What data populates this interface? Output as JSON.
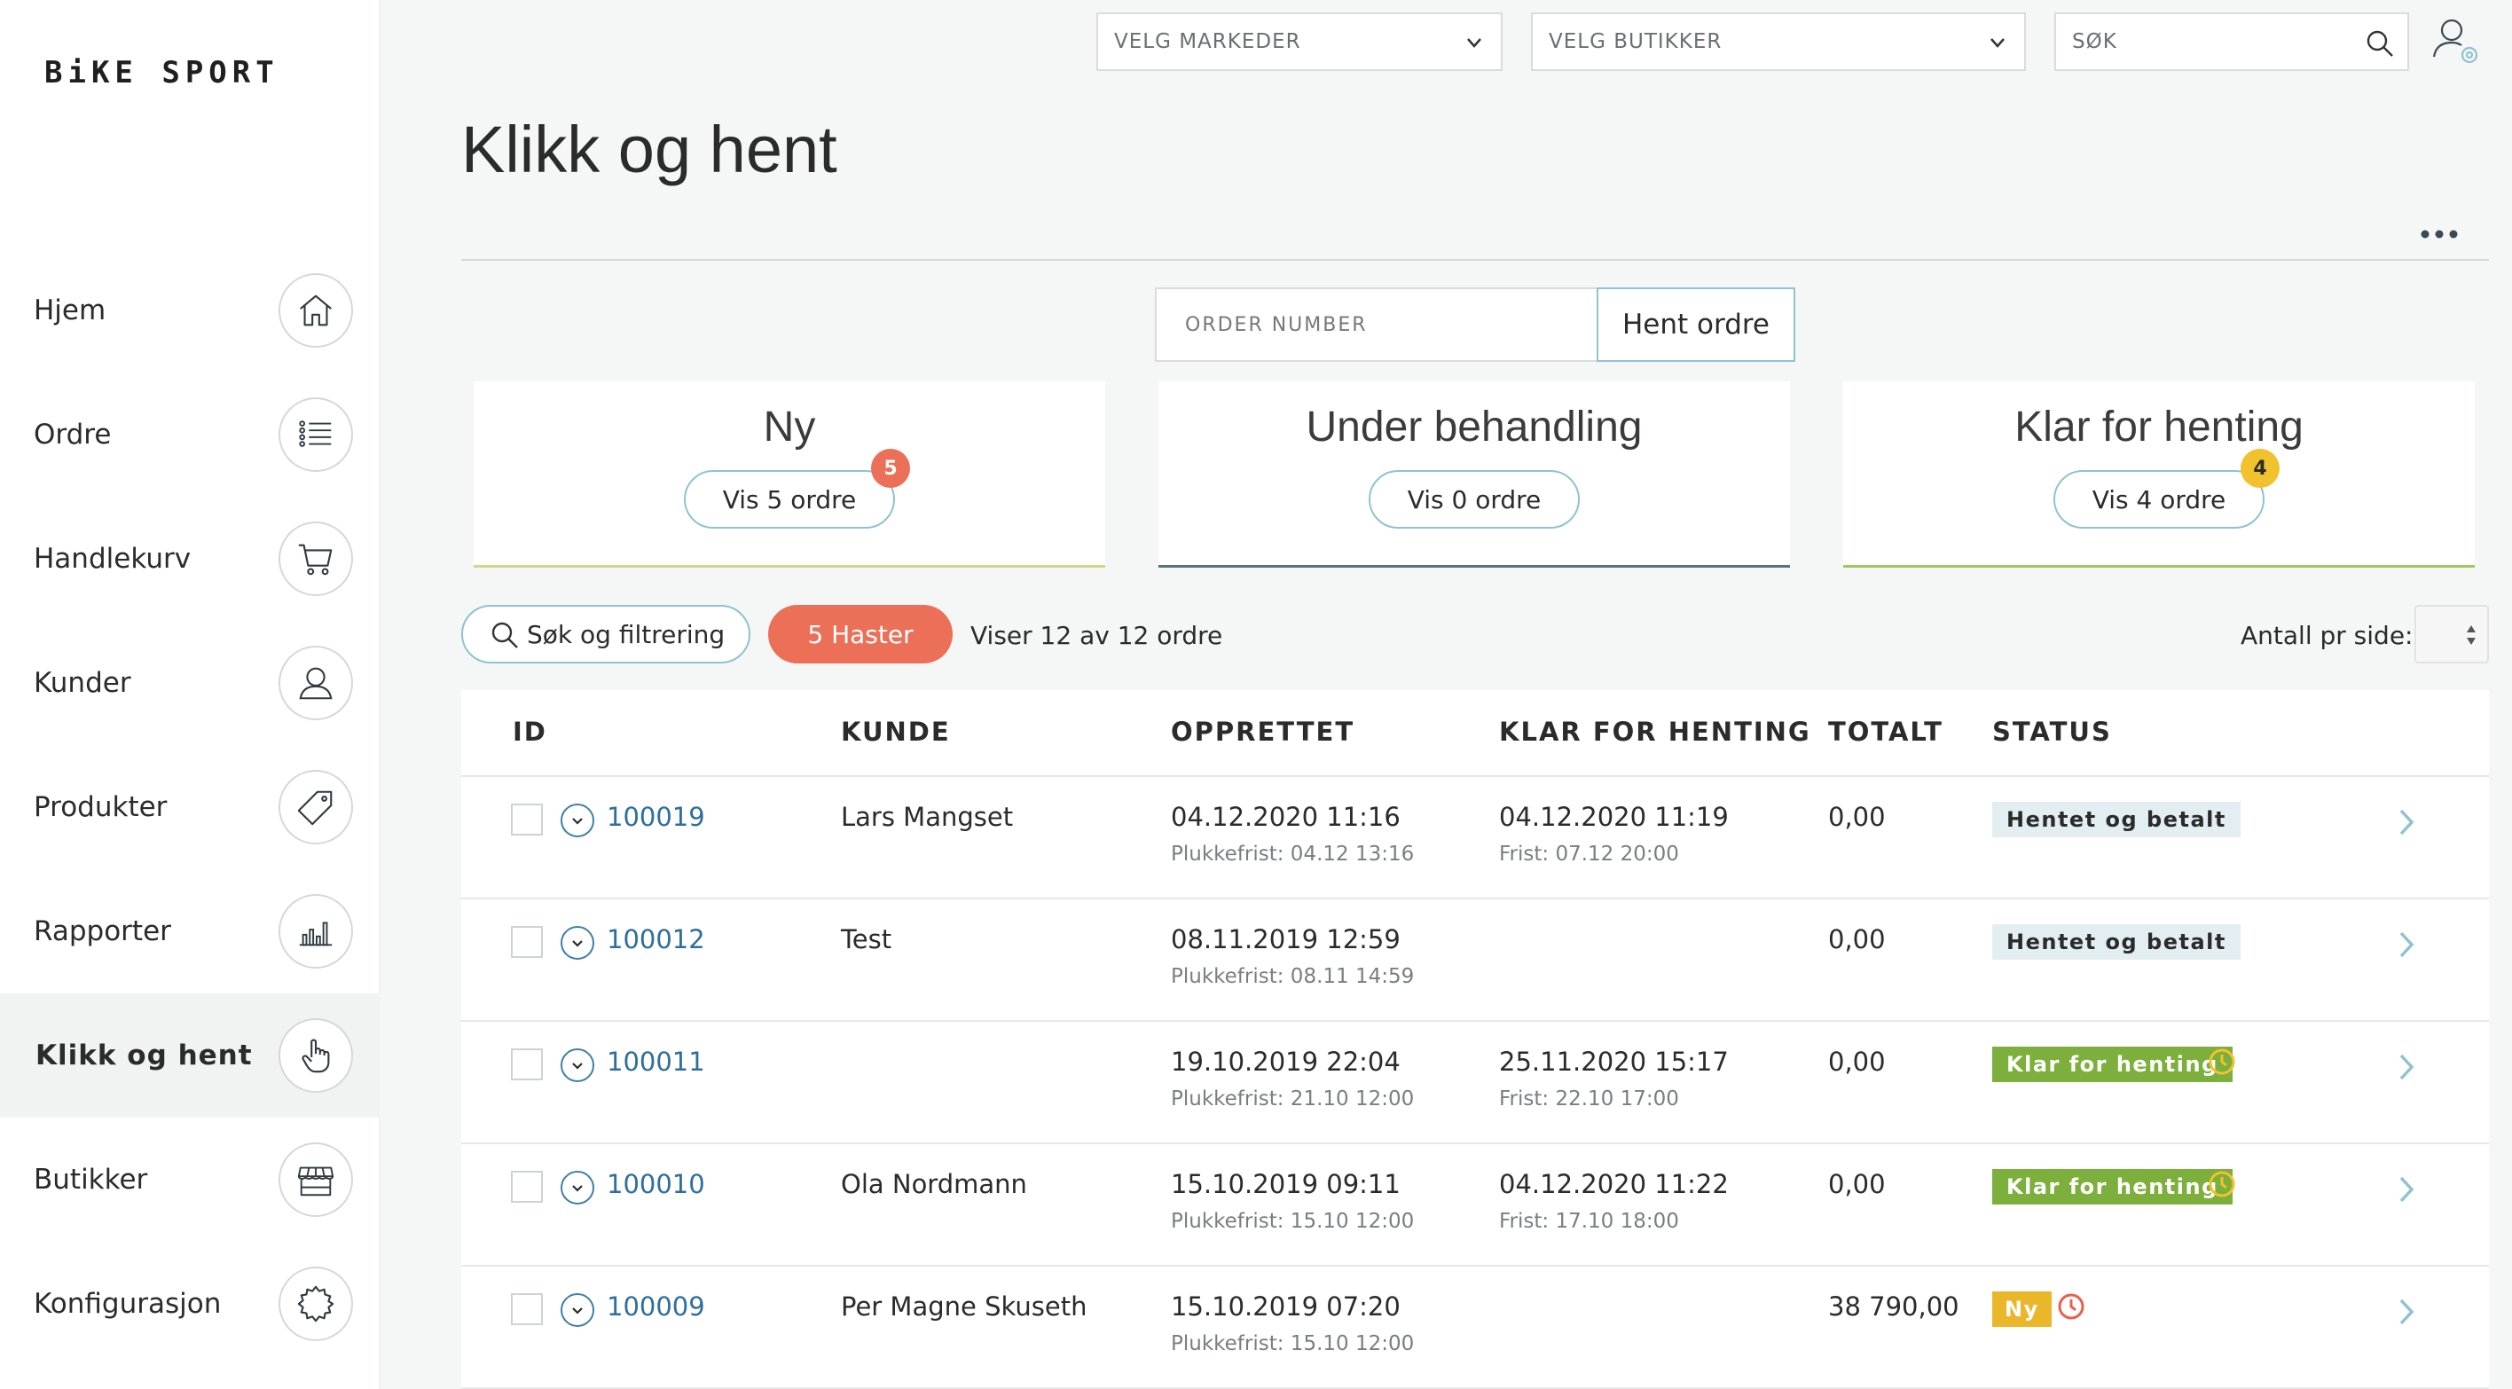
{
  "brand": {
    "logo": "BiKE SPORT"
  },
  "topbar": {
    "markets_select": "VELG MARKEDER",
    "stores_select": "VELG BUTIKKER",
    "search_placeholder": "SØK"
  },
  "sidebar": {
    "items": [
      {
        "label": "Hjem",
        "icon": "home-icon"
      },
      {
        "label": "Ordre",
        "icon": "list-icon"
      },
      {
        "label": "Handlekurv",
        "icon": "cart-icon"
      },
      {
        "label": "Kunder",
        "icon": "user-icon"
      },
      {
        "label": "Produkter",
        "icon": "tag-icon"
      },
      {
        "label": "Rapporter",
        "icon": "bar-chart-icon"
      },
      {
        "label": "Klikk og hent",
        "icon": "hand-pointer-icon",
        "active": true
      },
      {
        "label": "Butikker",
        "icon": "store-icon"
      },
      {
        "label": "Konfigurasjon",
        "icon": "settings-icon"
      }
    ]
  },
  "page": {
    "title": "Klikk og hent"
  },
  "order_lookup": {
    "placeholder": "ORDER NUMBER",
    "button": "Hent ordre"
  },
  "cards": [
    {
      "title": "Ny",
      "button": "Vis 5 ordre",
      "badge": "5",
      "badge_color": "#ec6f58",
      "line_color": "#d4d48a"
    },
    {
      "title": "Under behandling",
      "button": "Vis 0 ordre",
      "badge": "",
      "line_color": "#5b7280"
    },
    {
      "title": "Klar for henting",
      "button": "Vis 4 ordre",
      "badge": "4",
      "badge_color": "#f2c12e",
      "line_color": "#9fc95b"
    }
  ],
  "filters": {
    "search_filter": "Søk og filtrering",
    "urgent": "5 Haster",
    "showing": "Viser 12 av 12 ordre",
    "per_page_label": "Antall pr side:"
  },
  "table": {
    "headers": [
      "ID",
      "KUNDE",
      "OPPRETTET",
      "KLAR FOR HENTING",
      "TOTALT",
      "STATUS"
    ],
    "rows": [
      {
        "id": "100019",
        "kunde": "Lars Mangset",
        "opprettet": "04.12.2020 11:16",
        "plukkefrist": "Plukkefrist: 04.12 13:16",
        "klar": "04.12.2020 11:19",
        "frist": "Frist: 07.12 20:00",
        "totalt": "0,00",
        "status": "Hentet og betalt",
        "status_type": "hentet",
        "clock": ""
      },
      {
        "id": "100012",
        "kunde": "Test",
        "opprettet": "08.11.2019 12:59",
        "plukkefrist": "Plukkefrist: 08.11 14:59",
        "klar": "",
        "frist": "",
        "totalt": "0,00",
        "status": "Hentet og betalt",
        "status_type": "hentet",
        "clock": ""
      },
      {
        "id": "100011",
        "kunde": "",
        "opprettet": "19.10.2019 22:04",
        "plukkefrist": "Plukkefrist: 21.10 12:00",
        "klar": "25.11.2020 15:17",
        "frist": "Frist: 22.10 17:00",
        "totalt": "0,00",
        "status": "Klar for henting",
        "status_type": "klar",
        "clock": "#f2c12e"
      },
      {
        "id": "100010",
        "kunde": "Ola Nordmann",
        "opprettet": "15.10.2019 09:11",
        "plukkefrist": "Plukkefrist: 15.10 12:00",
        "klar": "04.12.2020 11:22",
        "frist": "Frist: 17.10 18:00",
        "totalt": "0,00",
        "status": "Klar for henting",
        "status_type": "klar",
        "clock": "#f2c12e"
      },
      {
        "id": "100009",
        "kunde": "Per Magne Skuseth",
        "opprettet": "15.10.2019 07:20",
        "plukkefrist": "Plukkefrist: 15.10 12:00",
        "klar": "",
        "frist": "",
        "totalt": "38 790,00",
        "status": "Ny",
        "status_type": "ny",
        "clock": "#e8604c"
      }
    ]
  }
}
